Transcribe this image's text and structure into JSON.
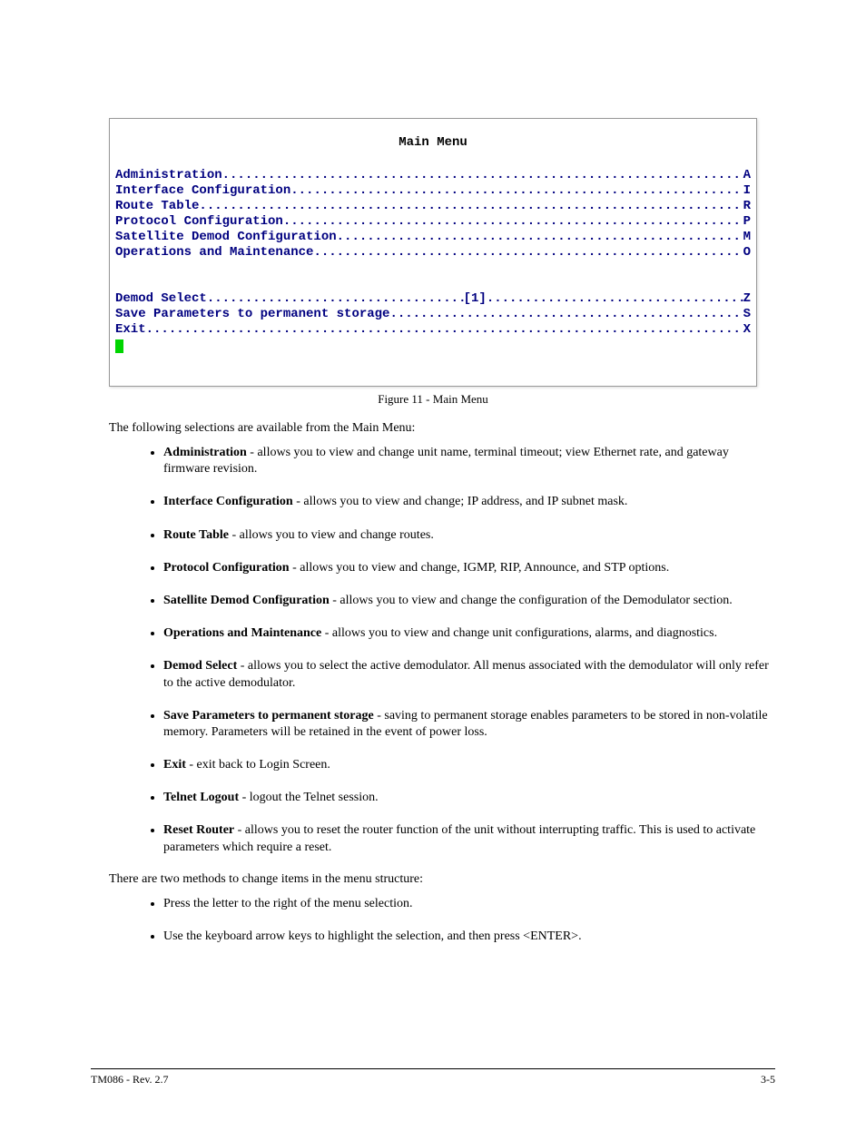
{
  "menu": {
    "title": "Main Menu",
    "group1": [
      {
        "label": "Administration",
        "key": "A"
      },
      {
        "label": "Interface Configuration",
        "key": "I"
      },
      {
        "label": "Route Table",
        "key": "R"
      },
      {
        "label": "Protocol Configuration",
        "key": "P"
      },
      {
        "label": "Satellite Demod Configuration",
        "key": "M"
      },
      {
        "label": "Operations and Maintenance",
        "key": "O"
      }
    ],
    "group2_special": {
      "label": "Demod Select",
      "mid": "[1]",
      "key": "Z"
    },
    "group2_rest": [
      {
        "label": "Save Parameters to permanent storage",
        "key": "S"
      },
      {
        "label": "Exit",
        "key": "X"
      }
    ],
    "dots": "........................................................................................................................"
  },
  "caption": "Figure 11 - Main Menu",
  "intro": "The following selections are available from the Main Menu:",
  "bullets": [
    {
      "head": "Administration",
      "body": "  - allows you to view and change unit name, terminal timeout; view Ethernet rate, and gateway firmware revision."
    },
    {
      "head": "Interface Configuration",
      "body": "  - allows you to view and change; IP address, and IP subnet mask."
    },
    {
      "head": "Route Table",
      "body": "  - allows you to view and change routes."
    },
    {
      "head": "Protocol Configuration",
      "body": "  - allows you to view and change, IGMP, RIP, Announce, and STP options."
    },
    {
      "head": "Satellite Demod Configuration",
      "body": "  - allows you to view and change the configuration of the Demodulator section."
    },
    {
      "head": "Operations and Maintenance",
      "body": "  - allows you to view and change unit configurations, alarms, and diagnostics."
    },
    {
      "head": "Demod Select",
      "body": "  - allows you to select the active demodulator. All menus associated with the demodulator will only refer to the active demodulator."
    },
    {
      "head": "Save Parameters to permanent storage",
      "body": "  - saving to permanent storage enables parameters to be stored in non-volatile memory. Parameters will be retained in the event of power loss."
    },
    {
      "head": "Exit",
      "body": "  - exit back to Login Screen."
    },
    {
      "head": "Telnet Logout",
      "body": "  - logout the Telnet session."
    },
    {
      "head": "Reset Router",
      "body": "  - allows you to reset the router function of the unit without interrupting traffic. This is used to activate parameters which require a reset."
    }
  ],
  "intro2": "There are two methods to change items in the menu structure:",
  "bullets2": [
    {
      "head": "",
      "body": "Press the letter to the right of the menu selection."
    },
    {
      "head": "",
      "body": "Use the keyboard arrow keys to highlight the selection, and then press <ENTER>."
    }
  ],
  "footer": {
    "left": "TM086 - Rev. 2.7",
    "right": "3-5"
  }
}
